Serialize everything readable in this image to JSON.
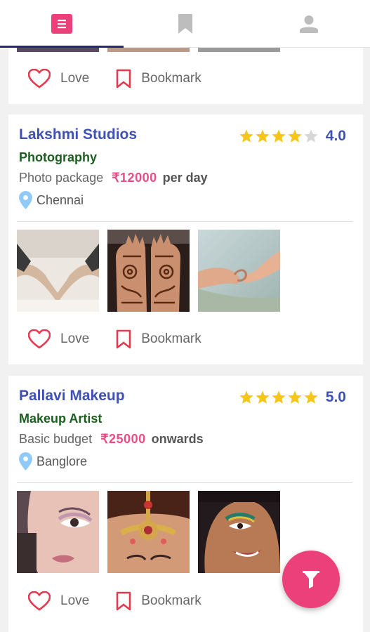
{
  "tabs": [
    {
      "name": "feed",
      "icon": "list-icon",
      "active": true
    },
    {
      "name": "bookmarks",
      "icon": "bookmark-icon",
      "active": false
    },
    {
      "name": "profile",
      "icon": "person-icon",
      "active": false
    }
  ],
  "actions": {
    "love_label": "Love",
    "bookmark_label": "Bookmark"
  },
  "listings": [
    {
      "name": "Lakshmi Studios",
      "rating": "4.0",
      "stars_filled": 4,
      "category": "Photography",
      "price_label": "Photo package",
      "price": "₹12000",
      "price_unit": "per day",
      "location": "Chennai",
      "photos": [
        "hands-heart-photo",
        "henna-hands-photo",
        "holding-fingers-photo"
      ]
    },
    {
      "name": "Pallavi Makeup",
      "rating": "5.0",
      "stars_filled": 5,
      "category": "Makeup Artist",
      "price_label": "Basic budget",
      "price": "₹25000",
      "price_unit": "onwards",
      "location": "Banglore",
      "photos": [
        "eye-makeup-photo",
        "bridal-jewelry-photo",
        "smiling-makeup-photo"
      ]
    }
  ],
  "colors": {
    "accent": "#ec407a",
    "title": "#3f51b5",
    "category": "#1b5e20",
    "price": "#e94c86",
    "star": "#f5c518"
  }
}
